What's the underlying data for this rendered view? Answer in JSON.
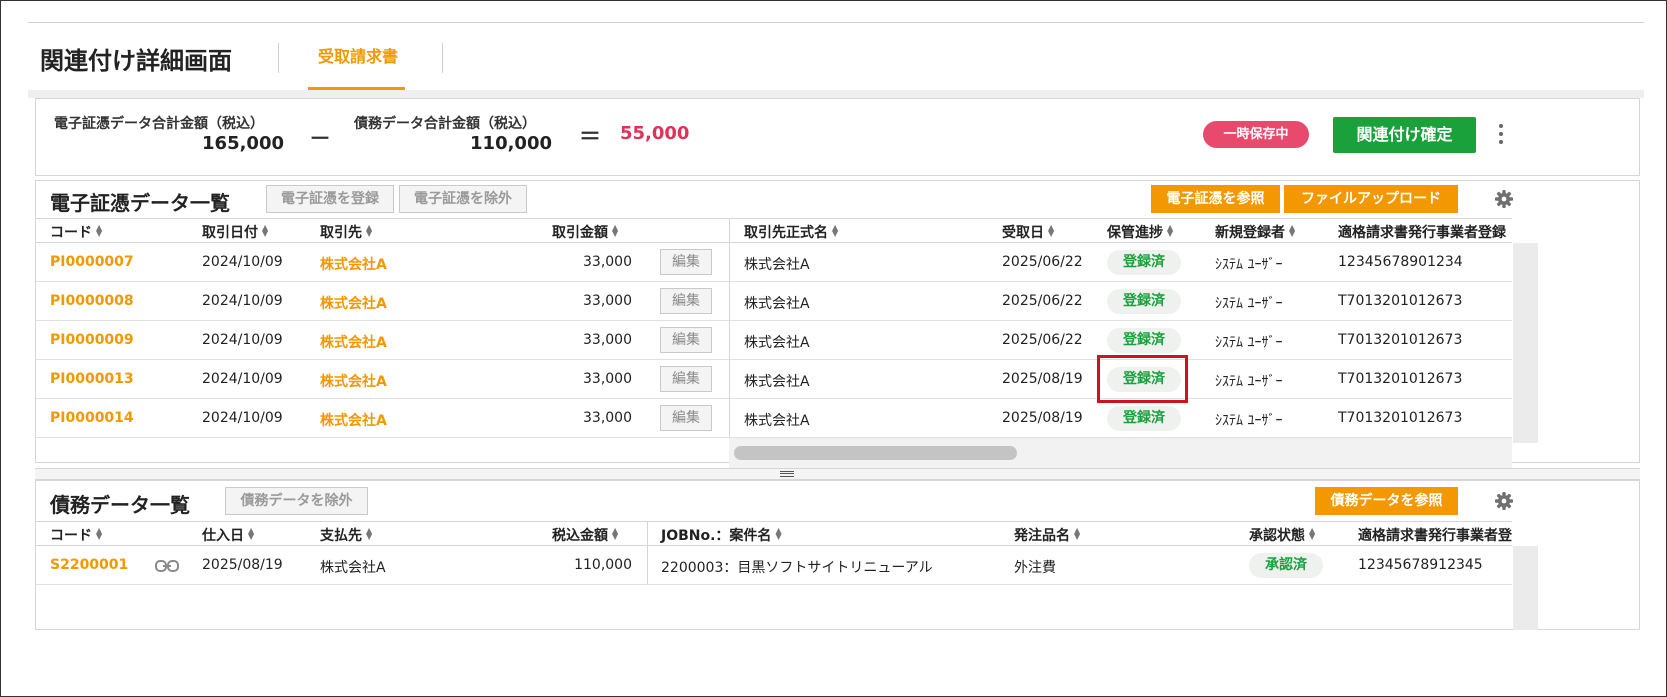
{
  "header": {
    "title": "関連付け詳細画面",
    "active_tab": "受取請求書"
  },
  "summary": {
    "ev_label": "電子証憑データ合計金額（税込）",
    "ev_total": "165,000",
    "minus": "－",
    "debt_label": "債務データ合計金額（税込）",
    "debt_total": "110,000",
    "equals": "＝",
    "difference": "55,000",
    "status_badge": "一時保存中",
    "confirm_button": "関連付け確定",
    "more_icon": "kebab-vertical-icon"
  },
  "evidence_panel": {
    "title": "電子証憑データ一覧",
    "register_button": "電子証憑を登録",
    "exclude_button": "電子証憑を除外",
    "browse_button": "電子証憑を参照",
    "upload_button": "ファイルアップロード",
    "settings_icon": "gear-icon",
    "columns": [
      "コード",
      "取引日付",
      "取引先",
      "取引金額",
      "取引先正式名",
      "受取日",
      "保管進捗",
      "新規登録者",
      "適格請求書発行事業者登録"
    ],
    "edit_label": "編集",
    "rows": [
      {
        "code": "PI0000007",
        "date": "2024/10/09",
        "partner": "株式会社A",
        "amount": "33,000",
        "official_name": "株式会社A",
        "received": "2025/06/22",
        "status": "登録済",
        "registrant": "ｼｽﾃﾑ ﾕｰｻﾞｰ",
        "invoice_no": "12345678901234"
      },
      {
        "code": "PI0000008",
        "date": "2024/10/09",
        "partner": "株式会社A",
        "amount": "33,000",
        "official_name": "株式会社A",
        "received": "2025/06/22",
        "status": "登録済",
        "registrant": "ｼｽﾃﾑ ﾕｰｻﾞｰ",
        "invoice_no": "T7013201012673"
      },
      {
        "code": "PI0000009",
        "date": "2024/10/09",
        "partner": "株式会社A",
        "amount": "33,000",
        "official_name": "株式会社A",
        "received": "2025/06/22",
        "status": "登録済",
        "registrant": "ｼｽﾃﾑ ﾕｰｻﾞｰ",
        "invoice_no": "T7013201012673"
      },
      {
        "code": "PI0000013",
        "date": "2024/10/09",
        "partner": "株式会社A",
        "amount": "33,000",
        "official_name": "株式会社A",
        "received": "2025/08/19",
        "status": "登録済",
        "registrant": "ｼｽﾃﾑ ﾕｰｻﾞｰ",
        "invoice_no": "T7013201012673"
      },
      {
        "code": "PI0000014",
        "date": "2024/10/09",
        "partner": "株式会社A",
        "amount": "33,000",
        "official_name": "株式会社A",
        "received": "2025/08/19",
        "status": "登録済",
        "registrant": "ｼｽﾃﾑ ﾕｰｻﾞｰ",
        "invoice_no": "T7013201012673"
      }
    ]
  },
  "debt_panel": {
    "title": "債務データ一覧",
    "exclude_button": "債務データを除外",
    "browse_button": "債務データを参照",
    "settings_icon": "gear-icon",
    "columns": [
      "コード",
      "仕入日",
      "支払先",
      "税込金額",
      "JOBNo.：案件名",
      "発注品名",
      "承認状態",
      "適格請求書発行事業者登"
    ],
    "rows": [
      {
        "code": "S2200001",
        "link_icon": "link-icon",
        "date": "2025/08/19",
        "payee": "株式会社A",
        "amount": "110,000",
        "job": "2200003：目黒ソフトサイトリニューアル",
        "item": "外注費",
        "status": "承認済",
        "invoice_no": "12345678912345"
      }
    ]
  },
  "colors": {
    "accent_orange": "#f39800",
    "confirm_green": "#1aa13c",
    "badge_pink": "#e84a6d",
    "difference_red": "#e0315a",
    "highlight_red": "#d0121b"
  }
}
